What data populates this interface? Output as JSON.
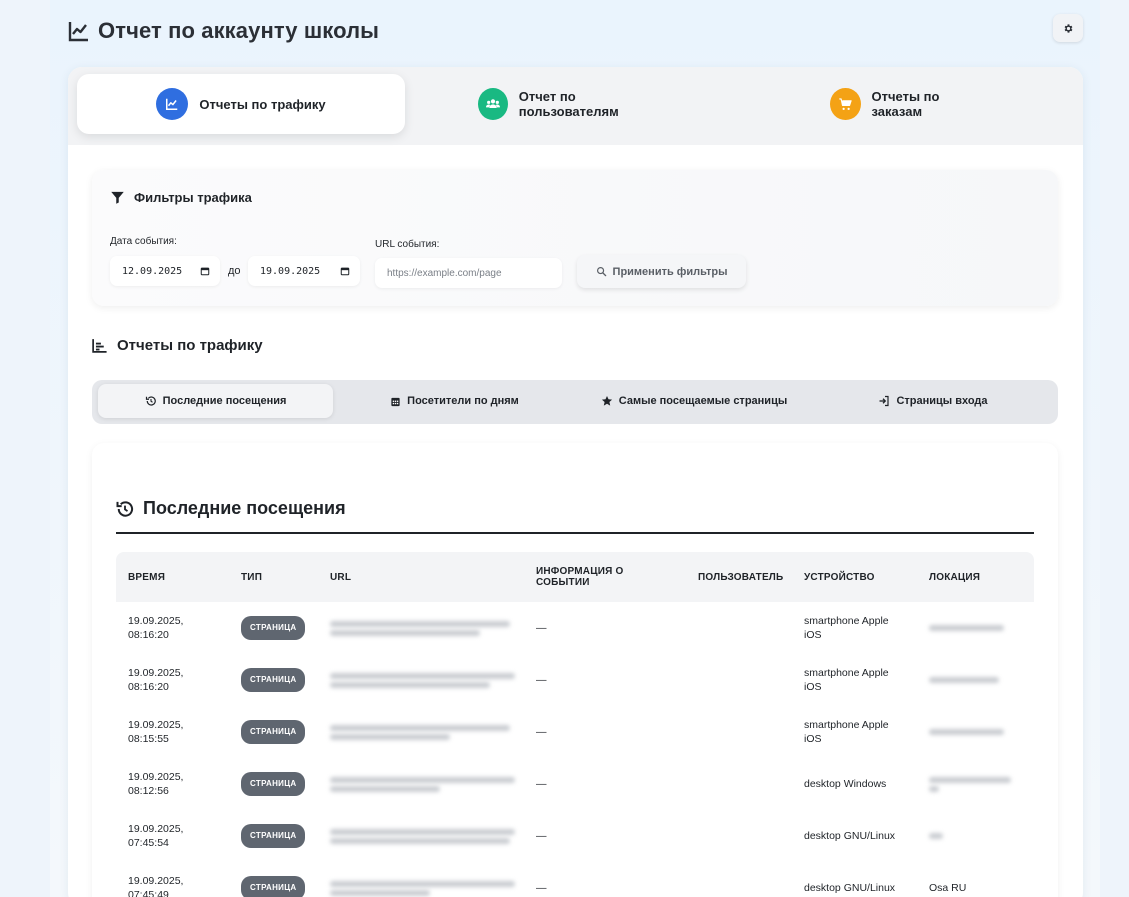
{
  "header": {
    "title": "Отчет по аккаунту школы"
  },
  "main_tabs": [
    {
      "label": "Отчеты по трафику",
      "color": "#2563eb",
      "icon": "chart-line-icon"
    },
    {
      "label": "Отчет по пользователям",
      "color": "#10b981",
      "icon": "users-icon"
    },
    {
      "label": "Отчеты по заказам",
      "color": "#f59e0b",
      "icon": "cart-icon"
    }
  ],
  "filters": {
    "title": "Фильтры трафика",
    "date_label": "Дата события:",
    "date_from": "12.09.2025",
    "date_sep": "до",
    "date_to": "19.09.2025",
    "url_label": "URL события:",
    "url_placeholder": "https://example.com/page",
    "apply_label": "Применить фильтры"
  },
  "traffic": {
    "title": "Отчеты по трафику",
    "sub_tabs": [
      {
        "label": "Последние посещения",
        "icon": "history-icon"
      },
      {
        "label": "Посетители по дням",
        "icon": "calendar-icon"
      },
      {
        "label": "Самые посещаемые страницы",
        "icon": "star-icon"
      },
      {
        "label": "Страницы входа",
        "icon": "sign-in-icon"
      }
    ]
  },
  "visits": {
    "title": "Последние посещения",
    "columns": [
      "Время",
      "Тип",
      "URL",
      "Информация о событии",
      "Пользователь",
      "Устройство",
      "Локация"
    ],
    "rows": [
      {
        "time": "19.09.2025, 08:16:20",
        "type": "Страница",
        "info": "—",
        "user": "",
        "device": "smartphone Apple iOS",
        "location": ""
      },
      {
        "time": "19.09.2025, 08:16:20",
        "type": "Страница",
        "info": "—",
        "user": "",
        "device": "smartphone Apple iOS",
        "location": ""
      },
      {
        "time": "19.09.2025, 08:15:55",
        "type": "Страница",
        "info": "—",
        "user": "",
        "device": "smartphone Apple iOS",
        "location": ""
      },
      {
        "time": "19.09.2025, 08:12:56",
        "type": "Страница",
        "info": "—",
        "user": "",
        "device": "desktop Windows",
        "location": ""
      },
      {
        "time": "19.09.2025, 07:45:54",
        "type": "Страница",
        "info": "—",
        "user": "",
        "device": "desktop GNU/Linux",
        "location": ""
      },
      {
        "time": "19.09.2025, 07:45:49",
        "type": "Страница",
        "info": "—",
        "user": "",
        "device": "desktop GNU/Linux",
        "location": "Osa RU"
      }
    ]
  }
}
